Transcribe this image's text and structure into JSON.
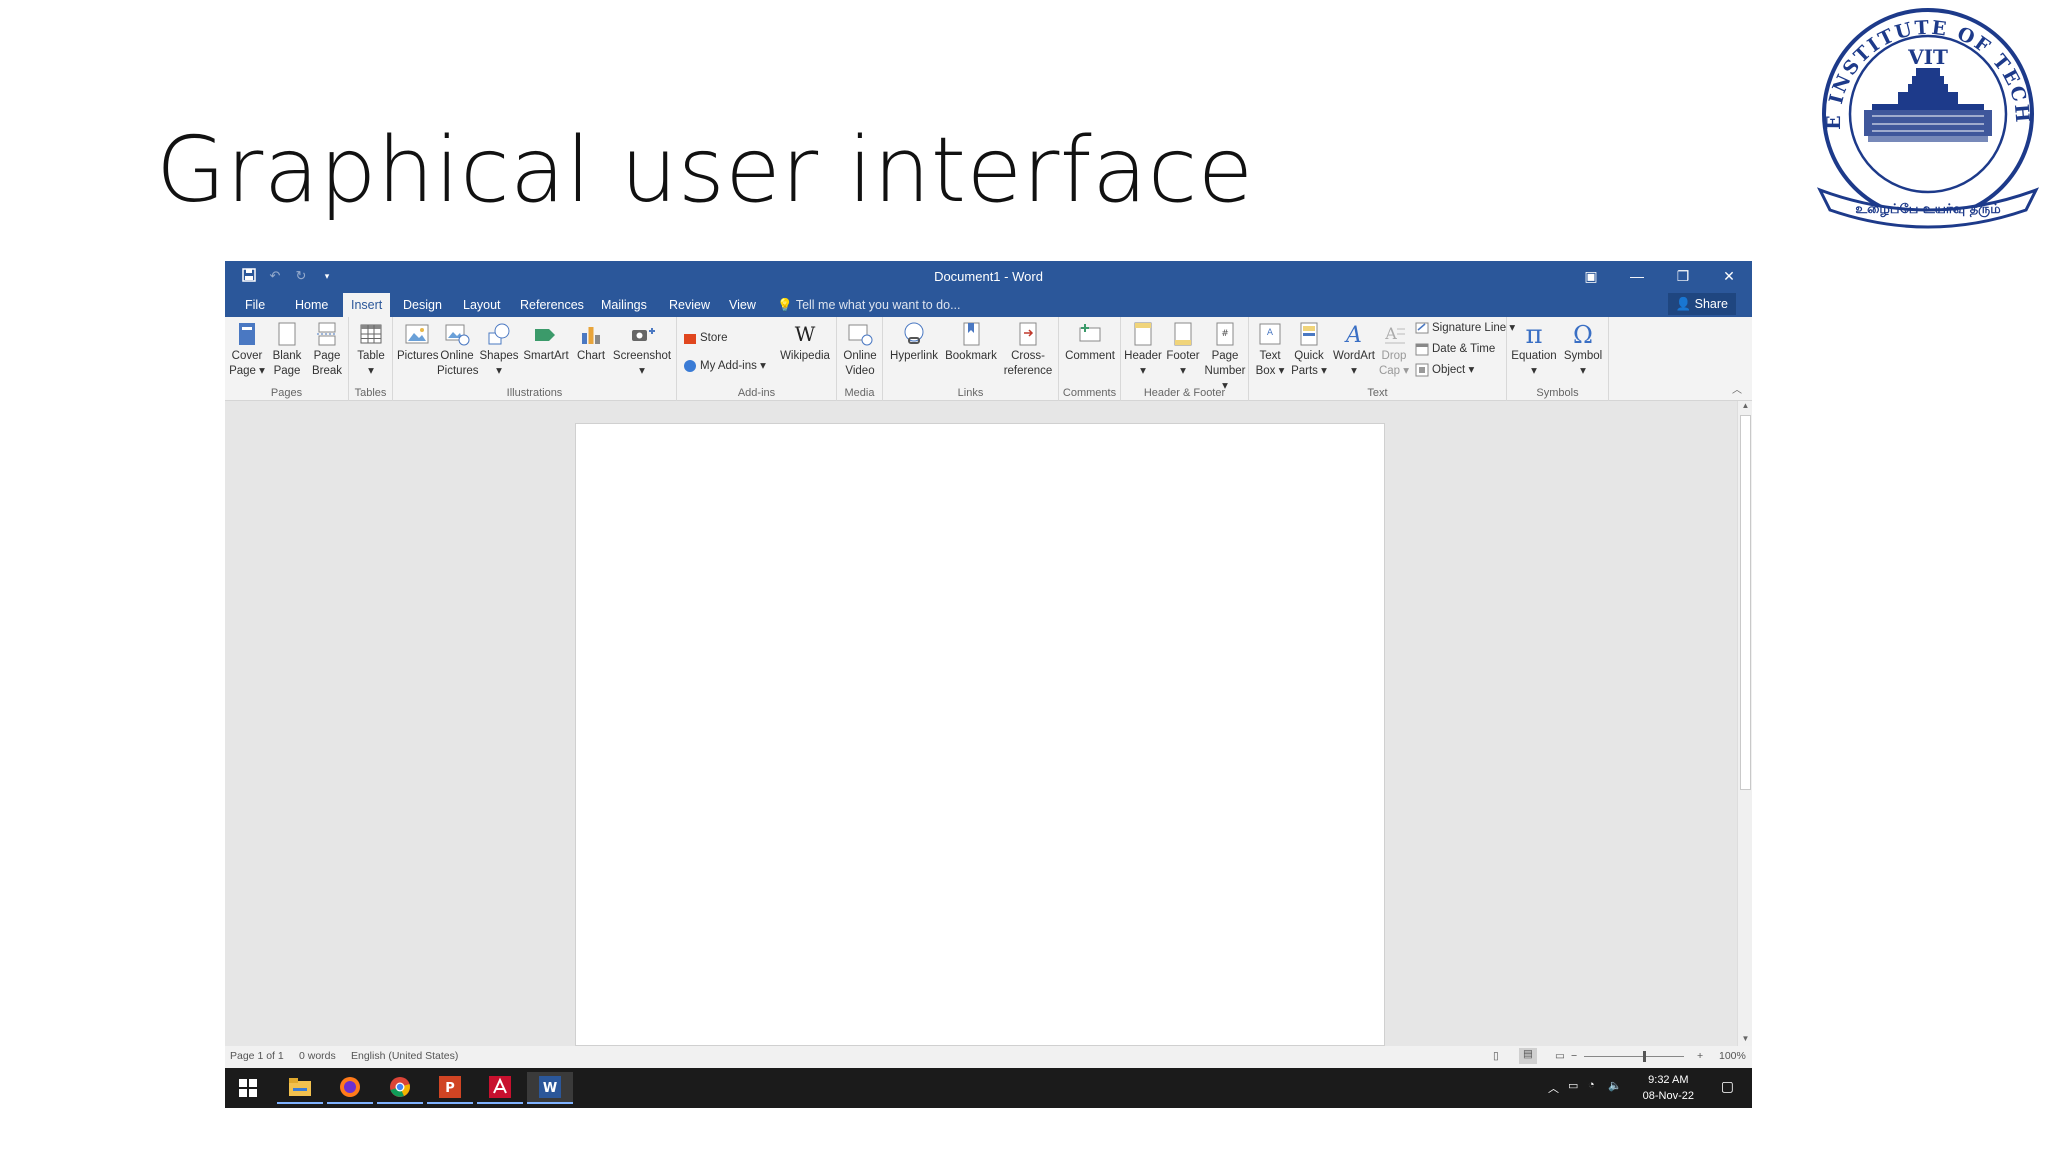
{
  "slide": {
    "title": "Graphical user interface",
    "logo": {
      "top_text": "VELLORE INSTITUTE OF TECHNOLOGY",
      "center_text": "VIT",
      "banner_text": "உழைப்பே உயர்வு தரும்"
    }
  },
  "window": {
    "title": "Document1 - Word",
    "controls": [
      "ribbon-display-icon",
      "minimize-icon",
      "restore-icon",
      "close-icon"
    ]
  },
  "tabs": [
    "File",
    "Home",
    "Insert",
    "Design",
    "Layout",
    "References",
    "Mailings",
    "Review",
    "View"
  ],
  "active_tab": "Insert",
  "tell_me": "Tell me what you want to do...",
  "share_label": "Share",
  "ribbon": {
    "pages": {
      "label": "Pages",
      "cover": [
        "Cover",
        "Page"
      ],
      "blank": [
        "Blank",
        "Page"
      ],
      "break": [
        "Page",
        "Break"
      ]
    },
    "tables": {
      "label": "Tables",
      "table": "Table"
    },
    "illustrations": {
      "label": "Illustrations",
      "pictures": "Pictures",
      "online_pictures": [
        "Online",
        "Pictures"
      ],
      "shapes": "Shapes",
      "smartart": "SmartArt",
      "chart": "Chart",
      "screenshot": "Screenshot"
    },
    "addins": {
      "label": "Add-ins",
      "store": "Store",
      "my_addins": "My Add-ins",
      "wikipedia": "Wikipedia"
    },
    "media": {
      "label": "Media",
      "online_video": [
        "Online",
        "Video"
      ]
    },
    "links": {
      "label": "Links",
      "hyperlink": "Hyperlink",
      "bookmark": "Bookmark",
      "crossref": [
        "Cross-",
        "reference"
      ]
    },
    "comments": {
      "label": "Comments",
      "comment": "Comment"
    },
    "header_footer": {
      "label": "Header & Footer",
      "header": "Header",
      "footer": "Footer",
      "page_number": [
        "Page",
        "Number"
      ]
    },
    "text": {
      "label": "Text",
      "text_box": [
        "Text",
        "Box"
      ],
      "quick_parts": [
        "Quick",
        "Parts"
      ],
      "wordart": "WordArt",
      "drop_cap": [
        "Drop",
        "Cap"
      ],
      "signature_line": "Signature Line",
      "date_time": "Date & Time",
      "object": "Object"
    },
    "symbols": {
      "label": "Symbols",
      "equation": "Equation",
      "symbol": "Symbol"
    }
  },
  "status": {
    "page": "Page 1 of 1",
    "words": "0 words",
    "language": "English (United States)",
    "zoom": "100%"
  },
  "taskbar": {
    "apps": [
      "start-icon",
      "file-explorer-icon",
      "firefox-icon",
      "chrome-icon",
      "powerpoint-icon",
      "acrobat-icon",
      "word-icon"
    ],
    "time": "9:32 AM",
    "date": "08-Nov-22"
  },
  "colors": {
    "word_blue": "#2b579a",
    "ribbon_bg": "#f3f3f3",
    "workspace_bg": "#e6e6e6",
    "taskbar_bg": "#1b1b1b"
  }
}
